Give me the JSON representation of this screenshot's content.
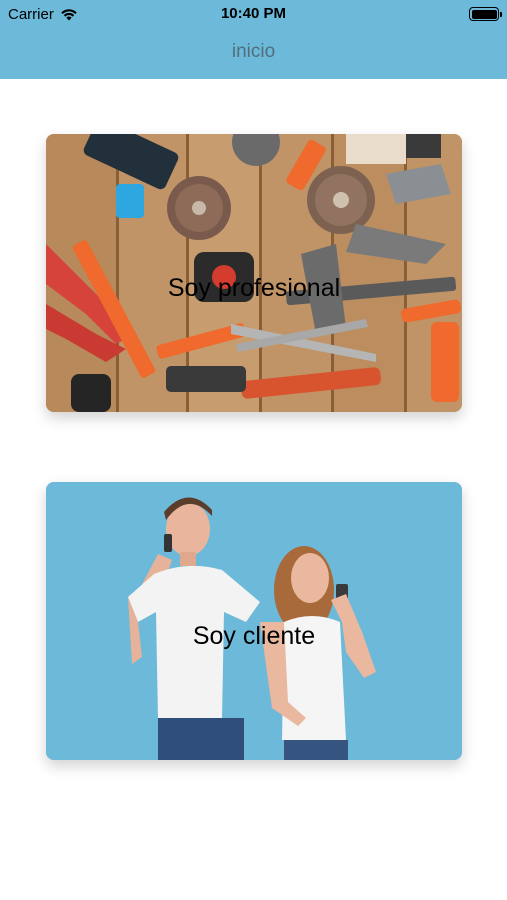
{
  "status_bar": {
    "carrier": "Carrier",
    "time": "10:40 PM",
    "battery_level": 1.0,
    "wifi_icon": "wifi-icon",
    "battery_icon": "battery-icon"
  },
  "nav": {
    "title": "inicio"
  },
  "cards": {
    "professional": {
      "label": "Soy profesional"
    },
    "client": {
      "label": "Soy cliente"
    }
  },
  "colors": {
    "nav_background": "#6db9d9",
    "client_card_background": "#6db9d9",
    "professional_card_background": "#b98a5a"
  }
}
